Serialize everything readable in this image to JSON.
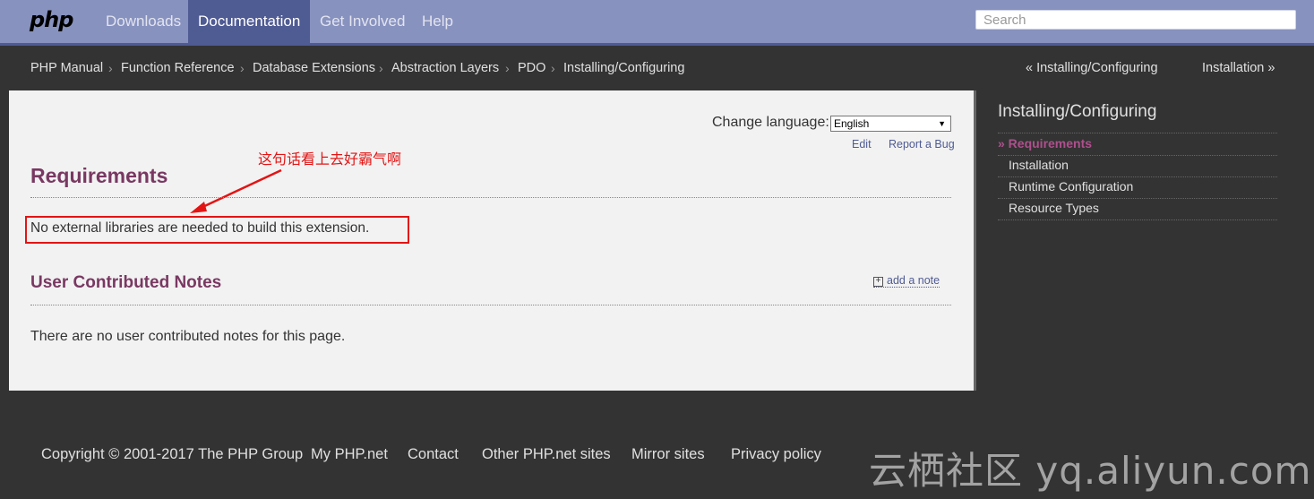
{
  "header": {
    "logo": "php",
    "nav": [
      "Downloads",
      "Documentation",
      "Get Involved",
      "Help"
    ],
    "active_nav": "Documentation",
    "search_placeholder": "Search"
  },
  "breadcrumb": {
    "items": [
      "PHP Manual",
      "Function Reference",
      "Database Extensions",
      "Abstraction Layers",
      "PDO",
      "Installing/Configuring"
    ],
    "separator": "›",
    "prev": "« Installing/Configuring",
    "next": "Installation »"
  },
  "content": {
    "change_language_label": "Change language:",
    "language_selected": "English",
    "edit_label": "Edit",
    "report_bug_label": "Report a Bug",
    "title": "Requirements",
    "body": "No external libraries are needed to build this extension.",
    "annotation": "这句话看上去好霸气啊",
    "notes_title": "User Contributed Notes",
    "add_note_label": "add a note",
    "no_notes_text": "There are no user contributed notes for this page."
  },
  "sidebar": {
    "title": "Installing/Configuring",
    "current": "» Requirements",
    "items": [
      "Installation",
      "Runtime Configuration",
      "Resource Types"
    ]
  },
  "footer": {
    "links": [
      "Copyright © 2001-2017 The PHP Group",
      "My PHP.net",
      "Contact",
      "Other PHP.net sites",
      "Mirror sites",
      "Privacy policy"
    ],
    "watermark": "云栖社区 yq.aliyun.com"
  },
  "colors": {
    "nav_bg": "#8892bf",
    "nav_active": "#4f5b93",
    "heading": "#793862",
    "sidebar_current": "#ae508d",
    "annotation": "#e31414"
  }
}
